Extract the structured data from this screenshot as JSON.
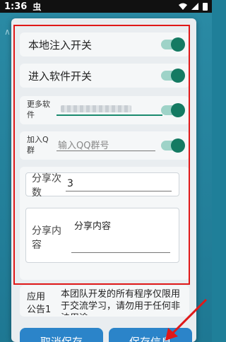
{
  "status_bar": {
    "time": "1:36",
    "app_icon_glyph": "虫",
    "wifi_icon": "wifi-icon",
    "signal_icon": "signal-icon",
    "battery_icon": "battery-icon"
  },
  "dialog": {
    "local_inject_label": "本地注入开关",
    "enter_software_label": "进入软件开关",
    "more_software_label": "更多软件",
    "join_qq_label": "加入Q群",
    "qq_placeholder": "输入QQ群号",
    "share_count_label": "分享次数",
    "share_count_value": "3",
    "share_content_label": "分享内容",
    "share_content_value": "分享内容",
    "announce_label": "应用公告1",
    "announce_text": "本团队开发的所有程序仅限用于交流学习，请勿用于任何非法用途",
    "cancel_button": "取消保存",
    "save_button": "保存信息"
  },
  "switches": {
    "local_inject": true,
    "enter_software": true,
    "more_software": true,
    "join_qq": true
  },
  "colors": {
    "switch_on": "#147a62",
    "button": "#2b84c9",
    "annotation": "#e01818"
  }
}
